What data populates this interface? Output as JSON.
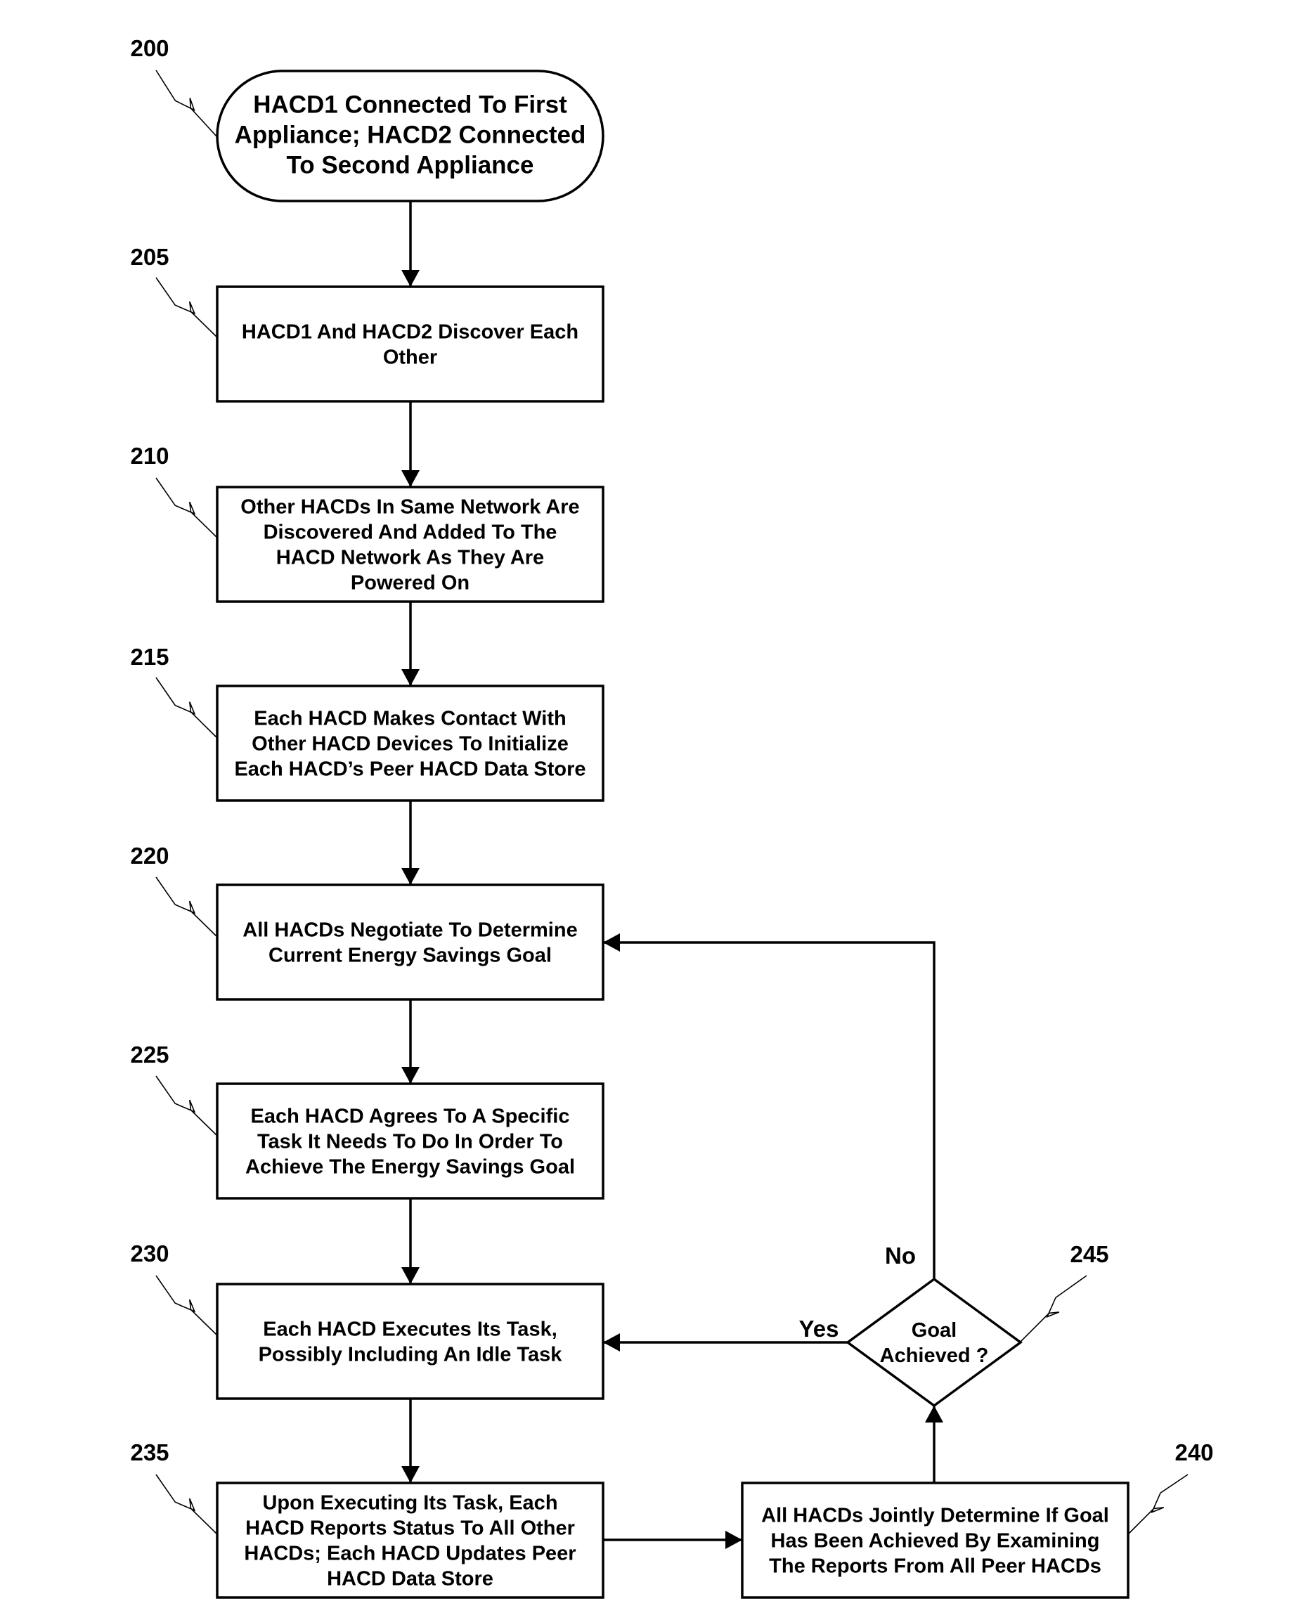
{
  "figure": {
    "type": "flowchart",
    "nodes": [
      {
        "id": "200",
        "ref": "200",
        "shape": "terminator",
        "lines": [
          "HACD1 Connected To First",
          "Appliance; HACD2 Connected",
          "To Second Appliance"
        ]
      },
      {
        "id": "205",
        "ref": "205",
        "shape": "process",
        "lines": [
          "HACD1 And HACD2 Discover Each",
          "Other"
        ]
      },
      {
        "id": "210",
        "ref": "210",
        "shape": "process",
        "lines": [
          "Other HACDs In Same Network Are",
          "Discovered And Added To The",
          "HACD Network As They Are",
          "Powered On"
        ]
      },
      {
        "id": "215",
        "ref": "215",
        "shape": "process",
        "lines": [
          "Each HACD Makes Contact With",
          "Other HACD Devices To Initialize",
          "Each HACD’s Peer HACD Data Store"
        ]
      },
      {
        "id": "220",
        "ref": "220",
        "shape": "process",
        "lines": [
          "All HACDs Negotiate To Determine",
          "Current Energy Savings Goal"
        ]
      },
      {
        "id": "225",
        "ref": "225",
        "shape": "process",
        "lines": [
          "Each HACD Agrees To A Specific",
          "Task It Needs To Do In Order To",
          "Achieve The Energy Savings Goal"
        ]
      },
      {
        "id": "230",
        "ref": "230",
        "shape": "process",
        "lines": [
          "Each HACD Executes Its Task,",
          "Possibly Including An Idle Task"
        ]
      },
      {
        "id": "235",
        "ref": "235",
        "shape": "process",
        "lines": [
          "Upon Executing Its Task, Each",
          "HACD Reports Status To All Other",
          "HACDs; Each HACD Updates Peer",
          "HACD Data Store"
        ]
      },
      {
        "id": "240",
        "ref": "240",
        "shape": "process",
        "lines": [
          "All HACDs Jointly Determine If Goal",
          "Has Been Achieved By Examining",
          "The Reports From All Peer HACDs"
        ]
      },
      {
        "id": "245",
        "ref": "245",
        "shape": "decision",
        "lines": [
          "Goal",
          "Achieved ?"
        ]
      }
    ],
    "edges": [
      {
        "from": "200",
        "to": "205",
        "label": ""
      },
      {
        "from": "205",
        "to": "210",
        "label": ""
      },
      {
        "from": "210",
        "to": "215",
        "label": ""
      },
      {
        "from": "215",
        "to": "220",
        "label": ""
      },
      {
        "from": "220",
        "to": "225",
        "label": ""
      },
      {
        "from": "225",
        "to": "230",
        "label": ""
      },
      {
        "from": "230",
        "to": "235",
        "label": ""
      },
      {
        "from": "235",
        "to": "240",
        "label": ""
      },
      {
        "from": "240",
        "to": "245",
        "label": ""
      },
      {
        "from": "245",
        "to": "230",
        "label": "Yes"
      },
      {
        "from": "245",
        "to": "220",
        "label": "No"
      }
    ]
  }
}
